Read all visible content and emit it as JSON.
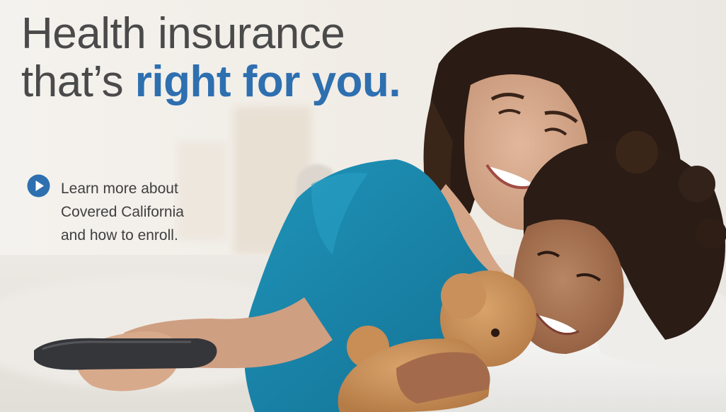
{
  "banner": {
    "headline_line1": "Health insurance",
    "headline_line2_prefix": "that’s ",
    "headline_line2_accent": "right for you.",
    "cta": {
      "icon": "play-circle-icon",
      "line1": "Learn more about",
      "line2": "Covered California",
      "line3": "and how to enroll."
    }
  },
  "colors": {
    "accent": "#2e6fb0",
    "headline_text": "#4a4a4a",
    "body_text": "#3f3f3f",
    "shirt": "#1a86a8"
  }
}
